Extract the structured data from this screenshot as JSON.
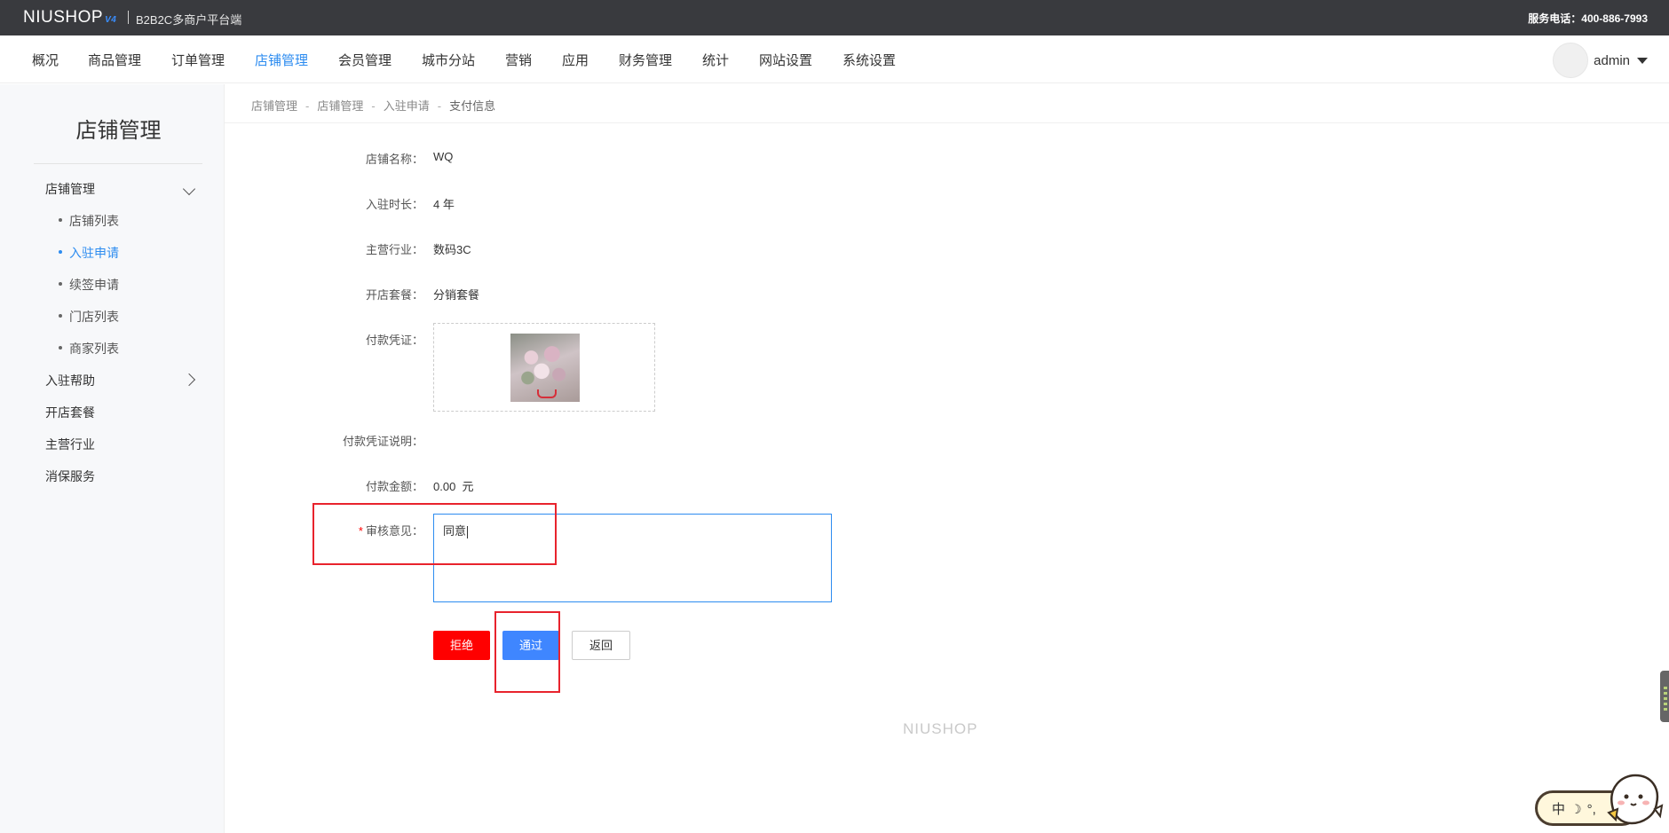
{
  "topbar": {
    "brand": "NIUSHOP",
    "brand_version": "V4",
    "subtitle": "B2B2C多商户平台端",
    "hotline": "服务电话：400-886-7993"
  },
  "nav": {
    "items": [
      "概况",
      "商品管理",
      "订单管理",
      "店铺管理",
      "会员管理",
      "城市分站",
      "营销",
      "应用",
      "财务管理",
      "统计",
      "网站设置",
      "系统设置"
    ],
    "active": "店铺管理",
    "user": "admin"
  },
  "sidebar": {
    "title": "店铺管理",
    "group_store": "店铺管理",
    "sub_items": [
      "店铺列表",
      "入驻申请",
      "续签申请",
      "门店列表",
      "商家列表"
    ],
    "active_sub": "入驻申请",
    "group_help": "入驻帮助",
    "item_package": "开店套餐",
    "item_industry": "主营行业",
    "item_guarantee": "消保服务"
  },
  "breadcrumb": [
    "店铺管理",
    "店铺管理",
    "入驻申请",
    "支付信息"
  ],
  "breadcrumb_sep": "-",
  "form": {
    "store_name_label": "店铺名称：",
    "store_name": "WQ",
    "duration_label": "入驻时长：",
    "duration": "4 年",
    "industry_label": "主营行业：",
    "industry": "数码3C",
    "package_label": "开店套餐：",
    "package": "分销套餐",
    "voucher_label": "付款凭证：",
    "voucher_desc_label": "付款凭证说明：",
    "amount_label": "付款金额：",
    "amount": "0.00",
    "amount_unit": "元",
    "required_mark": "*",
    "review_label": "审核意见：",
    "review_value": "同意"
  },
  "buttons": {
    "reject": "拒绝",
    "pass": "通过",
    "back": "返回"
  },
  "footer_logo": "NIUSHOP",
  "ime": {
    "lang": "中",
    "moon": "☽",
    "punct": "°,"
  },
  "colors": {
    "topbar_bg": "#393a3e",
    "accent": "#2d8cf0",
    "reject": "#ff0000",
    "pass": "#3f86ff",
    "annotation": "#e8232d"
  }
}
